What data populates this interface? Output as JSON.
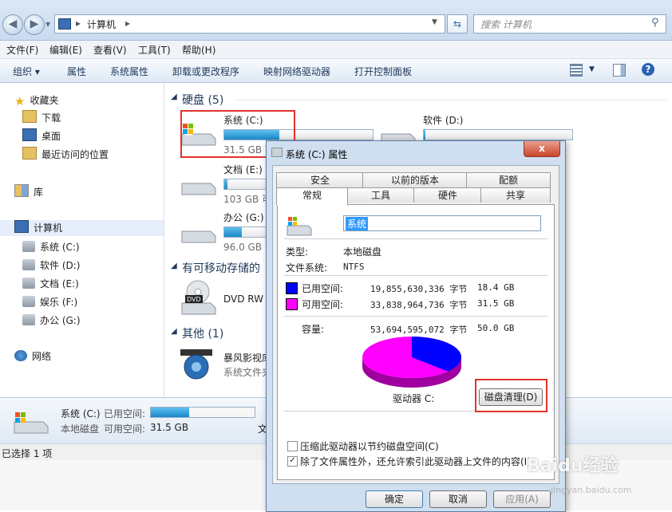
{
  "address": {
    "path": "计算机",
    "search_placeholder": "搜索 计算机"
  },
  "menu": [
    "文件(F)",
    "编辑(E)",
    "查看(V)",
    "工具(T)",
    "帮助(H)"
  ],
  "toolbar": [
    "组织 ▾",
    "属性",
    "系统属性",
    "卸载或更改程序",
    "映射网络驱动器",
    "打开控制面板"
  ],
  "nav": {
    "favorites": "收藏夹",
    "fav_items": [
      "下载",
      "桌面",
      "最近访问的位置"
    ],
    "library": "库",
    "computer": "计算机",
    "drives": [
      "系统 (C:)",
      "软件 (D:)",
      "文档 (E:)",
      "娱乐 (F:)",
      "办公 (G:)"
    ],
    "network": "网络"
  },
  "content": {
    "hdd_header": "硬盘 (5)",
    "removable_header": "有可移动存储的",
    "other_header": "其他 (1)",
    "drives": [
      {
        "name": "系统 (C:)",
        "size": "31.5 GB 可",
        "fill": 0.37
      },
      {
        "name": "软件 (D:)",
        "size": "",
        "fill": 0.01
      },
      {
        "name": "文档 (E:)",
        "size": "103 GB 可",
        "fill": 0.02
      },
      {
        "name": "办公 (G:)",
        "size": "96.0 GB 可",
        "fill": 0.12
      }
    ],
    "dvd": "DVD RW",
    "other_name": "暴风影视库",
    "other_sub": "系统文件夹"
  },
  "details": {
    "name": "系统 (C:)",
    "used_label": "已用空间:",
    "type": "本地磁盘",
    "free_label": "可用空间:",
    "free_value": "31.5 GB",
    "fill": 0.37,
    "extra": "文"
  },
  "status": "已选择 1 项",
  "dialog": {
    "title": "系统 (C:) 属性",
    "close": "x",
    "tabs_top": [
      "安全",
      "以前的版本",
      "配额"
    ],
    "tabs_bottom": [
      "常规",
      "工具",
      "硬件",
      "共享"
    ],
    "volume_name": "系统",
    "type_label": "类型:",
    "type_value": "本地磁盘",
    "fs_label": "文件系统:",
    "fs_value": "NTFS",
    "used_label": "已用空间:",
    "used_bytes": "19,855,630,336 字节",
    "used_gb": "18.4 GB",
    "free_label": "可用空间:",
    "free_bytes": "33,838,964,736 字节",
    "free_gb": "31.5 GB",
    "cap_label": "容量:",
    "cap_bytes": "53,694,595,072 字节",
    "cap_gb": "50.0 GB",
    "drive_label": "驱动器 C:",
    "cleanup": "磁盘清理(D)",
    "compress": "压缩此驱动器以节约磁盘空间(C)",
    "index": "除了文件属性外，还允许索引此驱动器上文件的内容(I)",
    "ok": "确定",
    "cancel": "取消",
    "apply": "应用(A)",
    "used_fraction": 0.37,
    "colors": {
      "used": "#0000ff",
      "free": "#ff00ff"
    }
  },
  "watermark": "Baidu经验 jingyan.baidu.com"
}
